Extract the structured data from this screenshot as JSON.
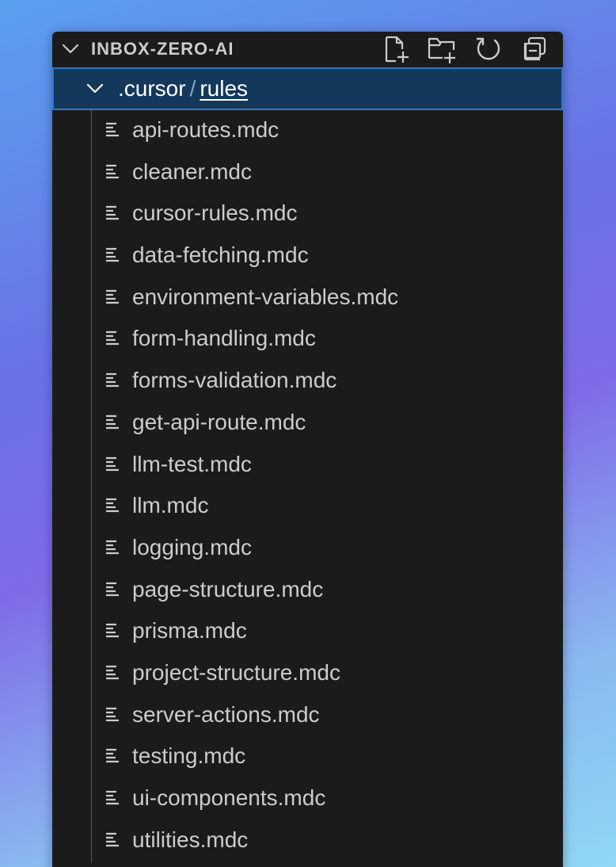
{
  "explorer": {
    "title": "INBOX-ZERO-AI",
    "actions": [
      {
        "name": "new-file-icon",
        "icon": "new-file"
      },
      {
        "name": "new-folder-icon",
        "icon": "new-folder"
      },
      {
        "name": "refresh-icon",
        "icon": "refresh"
      },
      {
        "name": "collapse-all-icon",
        "icon": "collapse-all"
      }
    ],
    "folder": {
      "name": ".cursor",
      "separator": "/",
      "subfolder": "rules"
    },
    "files": [
      {
        "label": "api-routes.mdc"
      },
      {
        "label": "cleaner.mdc"
      },
      {
        "label": "cursor-rules.mdc"
      },
      {
        "label": "data-fetching.mdc"
      },
      {
        "label": "environment-variables.mdc"
      },
      {
        "label": "form-handling.mdc"
      },
      {
        "label": "forms-validation.mdc"
      },
      {
        "label": "get-api-route.mdc"
      },
      {
        "label": "llm-test.mdc"
      },
      {
        "label": "llm.mdc"
      },
      {
        "label": "logging.mdc"
      },
      {
        "label": "page-structure.mdc"
      },
      {
        "label": "prisma.mdc"
      },
      {
        "label": "project-structure.mdc"
      },
      {
        "label": "server-actions.mdc"
      },
      {
        "label": "testing.mdc"
      },
      {
        "label": "ui-components.mdc"
      },
      {
        "label": "utilities.mdc"
      }
    ],
    "file_icon": "file-lines-icon",
    "colors": {
      "panel_bg": "#1b1b1c",
      "selected_bg": "#13385c",
      "selected_border": "#2b79c8",
      "text": "#cccccc"
    }
  }
}
